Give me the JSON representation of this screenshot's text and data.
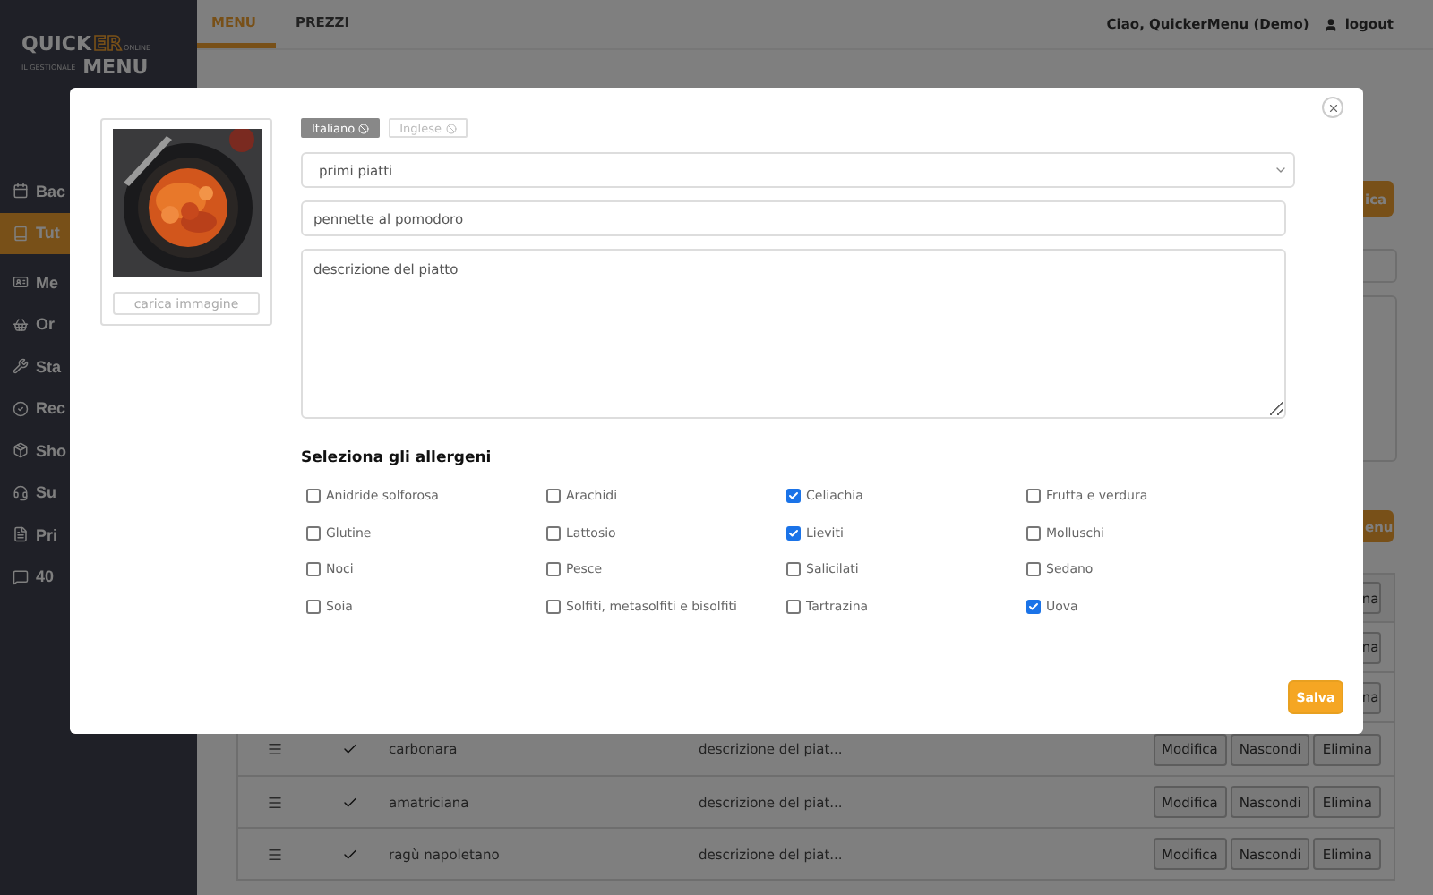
{
  "sidebar": {
    "logo": {
      "word": "QUICK",
      "accent": "ER",
      "tag": "ONLINE",
      "subtitle": "IL GESTIONALE",
      "word_2": "MENU"
    },
    "items": [
      {
        "label": "Bac",
        "selected": false
      },
      {
        "label": "Tut",
        "selected": true
      },
      {
        "label": "Me",
        "selected": false
      },
      {
        "label": "Or",
        "selected": false
      },
      {
        "label": "Sta",
        "selected": false
      },
      {
        "label": "Rec",
        "selected": false
      },
      {
        "label": "Sho",
        "selected": false
      },
      {
        "label": "Su",
        "selected": false
      },
      {
        "label": "Pri",
        "selected": false
      },
      {
        "label": "40",
        "selected": false
      }
    ]
  },
  "topbar": {
    "tabs": [
      {
        "label": "MENU",
        "selected": true
      },
      {
        "label": "PREZZI",
        "selected": false
      }
    ],
    "greeting": "Ciao, QuickerMenu (Demo)",
    "logout": "logout"
  },
  "page": {
    "top_button": "ica",
    "add_button": "enu",
    "partial_rows": [
      {
        "button": "na"
      },
      {
        "button": "na"
      },
      {
        "button": "na"
      }
    ],
    "rows": [
      {
        "name": "carbonara",
        "description": "descrizione del piat...",
        "visible": true,
        "buttons": [
          "Modifica",
          "Nascondi",
          "Elimina"
        ]
      },
      {
        "name": "amatriciana",
        "description": "descrizione del piat...",
        "visible": true,
        "buttons": [
          "Modifica",
          "Nascondi",
          "Elimina"
        ]
      },
      {
        "name": "ragù napoletano",
        "description": "descrizione del piat...",
        "visible": true,
        "buttons": [
          "Modifica",
          "Nascondi",
          "Elimina"
        ]
      }
    ]
  },
  "modal": {
    "upload_button": "carica immagine",
    "languages": [
      {
        "label": "Italiano",
        "selected": true
      },
      {
        "label": "Inglese",
        "selected": false
      }
    ],
    "category": "primi piatti",
    "name": "pennette al pomodoro",
    "description_placeholder": "descrizione del piatto",
    "allergens_title": "Seleziona gli allergeni",
    "allergens": [
      {
        "label": "Anidride solforosa",
        "checked": false
      },
      {
        "label": "Arachidi",
        "checked": false
      },
      {
        "label": "Celiachia",
        "checked": true
      },
      {
        "label": "Frutta e verdura",
        "checked": false
      },
      {
        "label": "Glutine",
        "checked": false
      },
      {
        "label": "Lattosio",
        "checked": false
      },
      {
        "label": "Lieviti",
        "checked": true
      },
      {
        "label": "Molluschi",
        "checked": false
      },
      {
        "label": "Noci",
        "checked": false
      },
      {
        "label": "Pesce",
        "checked": false
      },
      {
        "label": "Salicilati",
        "checked": false
      },
      {
        "label": "Sedano",
        "checked": false
      },
      {
        "label": "Soia",
        "checked": false
      },
      {
        "label": "Solfiti, metasolfiti e bisolfiti",
        "checked": false
      },
      {
        "label": "Tartrazina",
        "checked": false
      },
      {
        "label": "Uova",
        "checked": true
      }
    ],
    "save_button": "Salva"
  }
}
